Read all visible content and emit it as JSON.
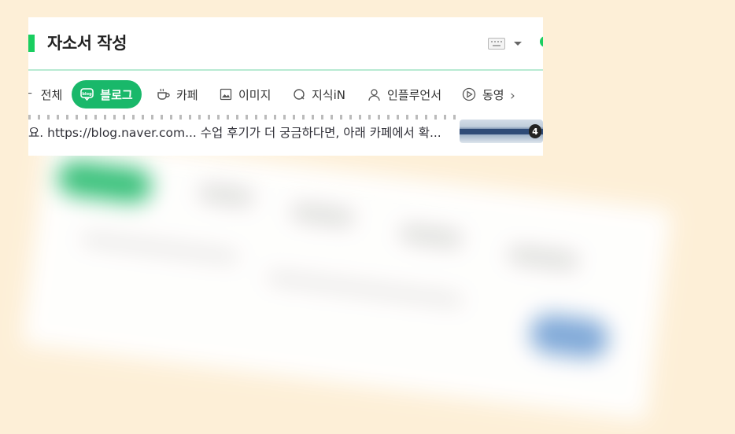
{
  "header": {
    "title": "자소서 작성",
    "icons": [
      "keyboard-icon",
      "caret-down-icon"
    ],
    "accent_color": "#19ce60"
  },
  "tabs": [
    {
      "label": "전체",
      "icon": "all-icon"
    },
    {
      "label": "블로그",
      "icon": "blog-icon",
      "active": true
    },
    {
      "label": "카페",
      "icon": "cafe-icon"
    },
    {
      "label": "이미지",
      "icon": "image-icon"
    },
    {
      "label": "지식iN",
      "icon": "kin-icon"
    },
    {
      "label": "인플루언서",
      "icon": "person-icon"
    },
    {
      "label": "동영",
      "icon": "play-icon"
    }
  ],
  "result": {
    "snippet": "요. https://blog.naver.com... 수업 후기가 더 궁금하다면, 아래 카페에서 확...",
    "thumb_count": "4"
  },
  "colors": {
    "active_tab_bg": "#19b86a",
    "background": "#fdefd7"
  }
}
